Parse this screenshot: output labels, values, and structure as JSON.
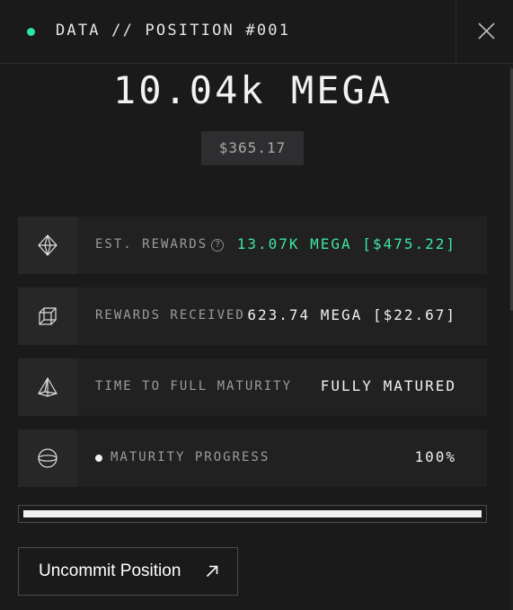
{
  "header": {
    "title": "DATA // POSITION #001",
    "status_color": "#2ee59d",
    "close_icon": "close-icon"
  },
  "position": {
    "amount": "10.04k MEGA",
    "usd_value": "$365.17"
  },
  "rows": [
    {
      "icon": "octahedron-icon",
      "label": "EST. REWARDS",
      "help_icon": "?",
      "value": "13.07K MEGA [$475.22]",
      "value_color": "#3ee6a4"
    },
    {
      "icon": "cube-icon",
      "label": "REWARDS RECEIVED",
      "value": "623.74 MEGA [$22.67]"
    },
    {
      "icon": "pyramid-icon",
      "label": "TIME TO FULL MATURITY",
      "value": "FULLY MATURED"
    },
    {
      "icon": "sphere-icon",
      "label": "MATURITY PROGRESS",
      "value": "100%"
    }
  ],
  "progress": {
    "fraction": 1.0
  },
  "action": {
    "label": "Uncommit Position",
    "icon": "arrow-up-right-icon"
  }
}
